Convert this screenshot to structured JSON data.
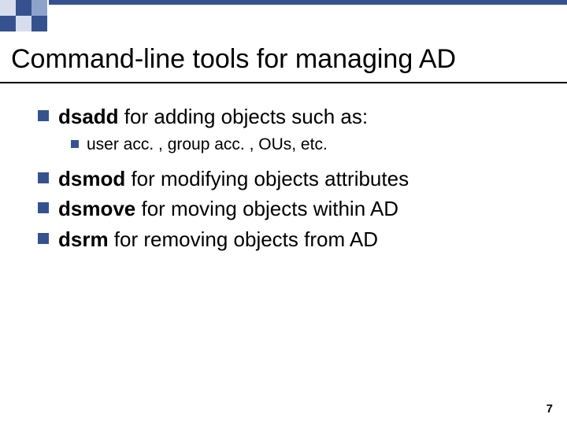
{
  "title": "Command-line tools for managing AD",
  "bullets": {
    "b1_cmd": "dsadd",
    "b1_rest": " for adding objects such as:",
    "b1_sub": "user acc. , group acc. , OUs, etc.",
    "b2_cmd": "dsmod",
    "b2_rest": " for modifying objects attributes",
    "b3_cmd": "dsmove",
    "b3_rest": " for moving objects within AD",
    "b4_cmd": "dsrm",
    "b4_rest": " for removing objects from AD"
  },
  "page_number": "7",
  "deco_colors": {
    "dark": "#35528f",
    "mid": "#8ea2cc",
    "light": "#d6deee"
  }
}
